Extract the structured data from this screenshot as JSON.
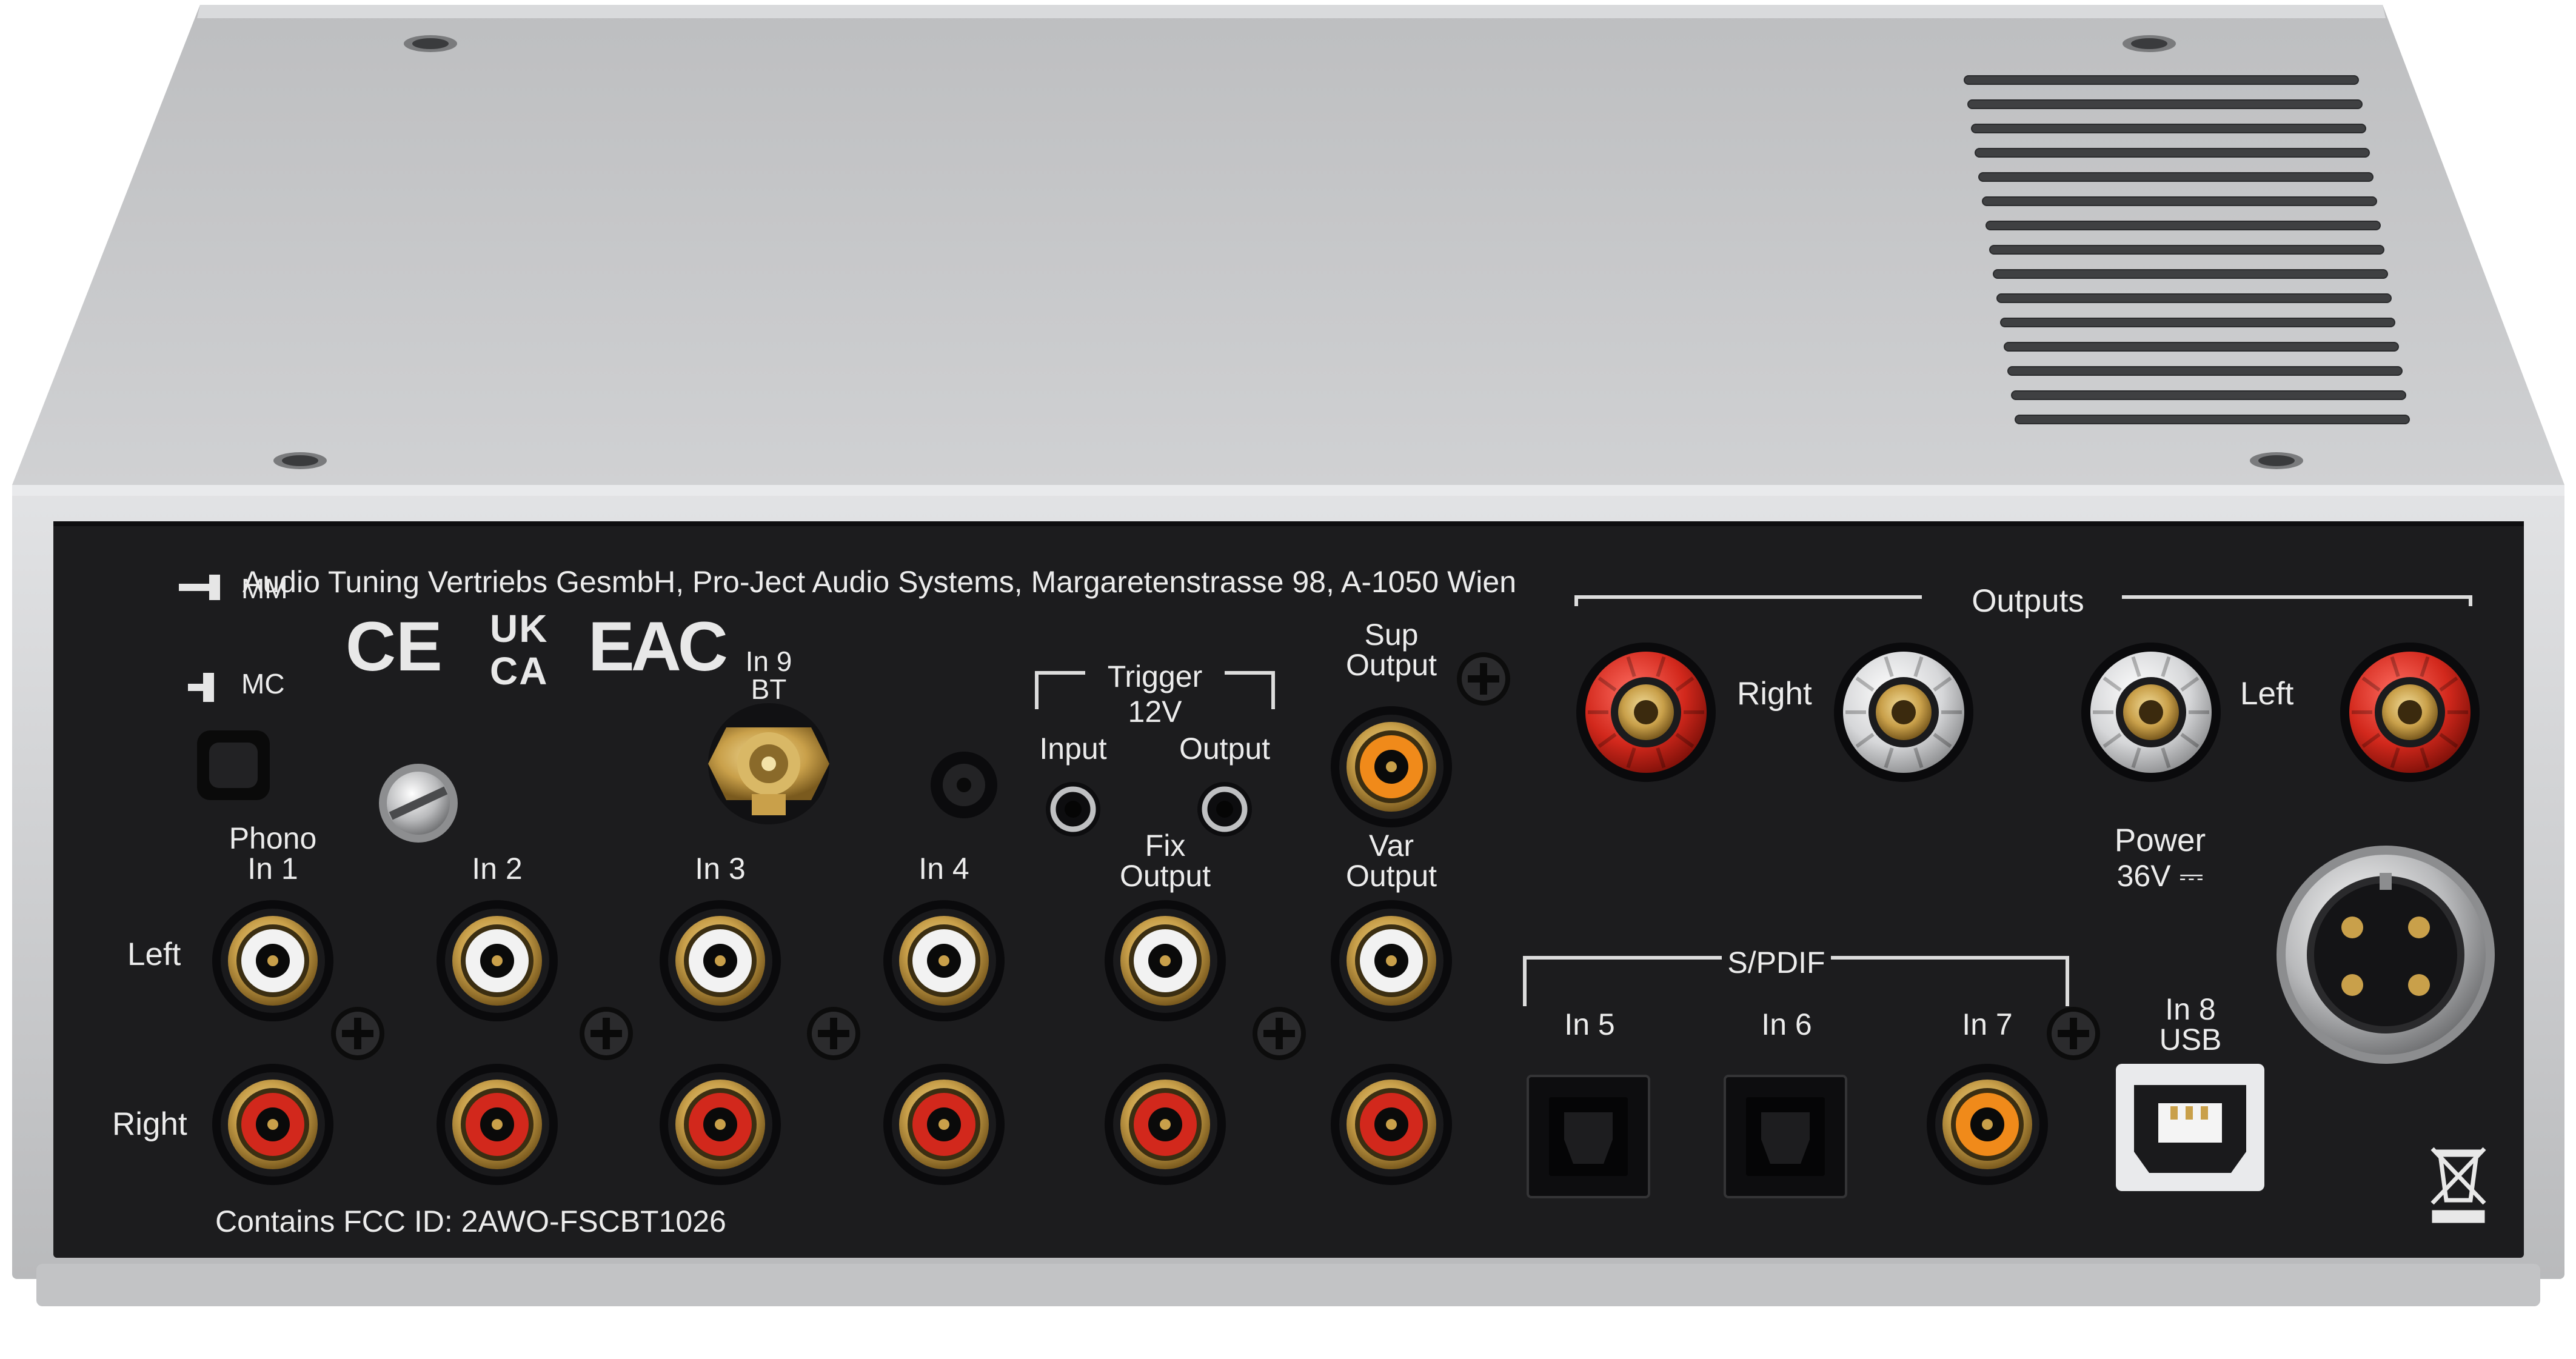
{
  "device": {
    "address": "Audio Tuning Vertriebs GesmbH, Pro-Ject Audio Systems, Margaretenstrasse 98, A-1050 Wien",
    "fcc": "Contains FCC ID: 2AWO-FSCBT1026",
    "marks": {
      "ce": "CE",
      "ukca_top": "UK",
      "ukca_bottom": "CA",
      "eac": "EAC"
    }
  },
  "phono_switch": {
    "mm": "MM",
    "mc": "MC"
  },
  "analog_inputs": {
    "row_left": "Left",
    "row_right": "Right",
    "in1": "Phono\nIn 1",
    "in2": "In 2",
    "in3": "In 3",
    "in4": "In 4",
    "fix_output": "Fix\nOutput",
    "var_output": "Var\nOutput"
  },
  "bt": {
    "label": "In 9\nBT"
  },
  "trigger": {
    "title": "Trigger\n12V",
    "input": "Input",
    "output": "Output"
  },
  "sup_output": "Sup\nOutput",
  "speaker_outputs": {
    "title": "Outputs",
    "right": "Right",
    "left": "Left"
  },
  "power": {
    "label": "Power",
    "voltage": "36V ⎓"
  },
  "spdif": {
    "title": "S/PDIF",
    "in5": "In 5",
    "in6": "In 6",
    "in7": "In 7"
  },
  "usb": {
    "label": "In 8\nUSB"
  },
  "colors": {
    "chassis_top": "#c7c8ca",
    "chassis_front": "#d3d4d6",
    "panel": "#1c1c1e",
    "rca_white": "#f2f2f2",
    "rca_red": "#d2281c",
    "coax_orange": "#f08a1a",
    "gold": "#c9a04a"
  }
}
